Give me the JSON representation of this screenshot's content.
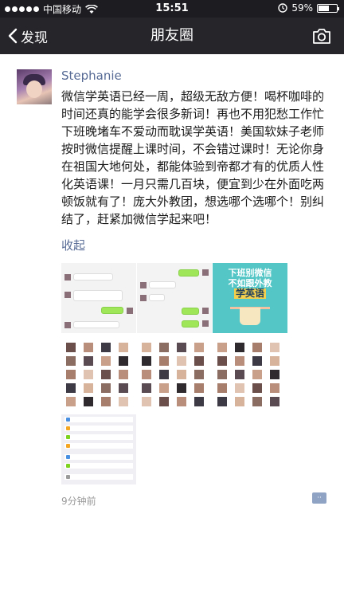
{
  "status_bar": {
    "carrier": "中国移动",
    "time": "15:51",
    "battery_text": "59%",
    "battery_level": 0.59,
    "icons": [
      "signal-dots-icon",
      "wifi-icon",
      "alarm-icon",
      "battery-icon"
    ]
  },
  "nav": {
    "back_label": "发现",
    "title": "朋友圈",
    "icons": [
      "chevron-left-icon",
      "camera-icon"
    ]
  },
  "post": {
    "username": "Stephanie",
    "text": "微信学英语已经一周，超级无敌方便！喝杯咖啡的时间还真的能学会很多新词！再也不用犯愁工作忙下班晚堵车不爱动而耽误学英语！美国软妹子老师按时微信提醒上课时间，不会错过课时！无论你身在祖国大地何处，都能体验到帝都才有的优质人性化英语课！一月只需几百块，便宜到少在外面吃两顿饭就有了！庞大外教团，想选哪个选哪个！别纠结了，赶紧加微信学起来吧！",
    "collapse_label": "收起",
    "poster": {
      "line1": "下班别微信",
      "line2": "不如跟外教",
      "line3": "学英语"
    },
    "timestamp": "9分钟前",
    "comment_icon": "comment-bubble-icon"
  },
  "colors": {
    "statusbar_bg": "#1d1c21",
    "navbar_bg": "#26252a",
    "link_blue": "#576b95",
    "poster_teal": "#55c6c6",
    "chat_green": "#9fe658"
  }
}
